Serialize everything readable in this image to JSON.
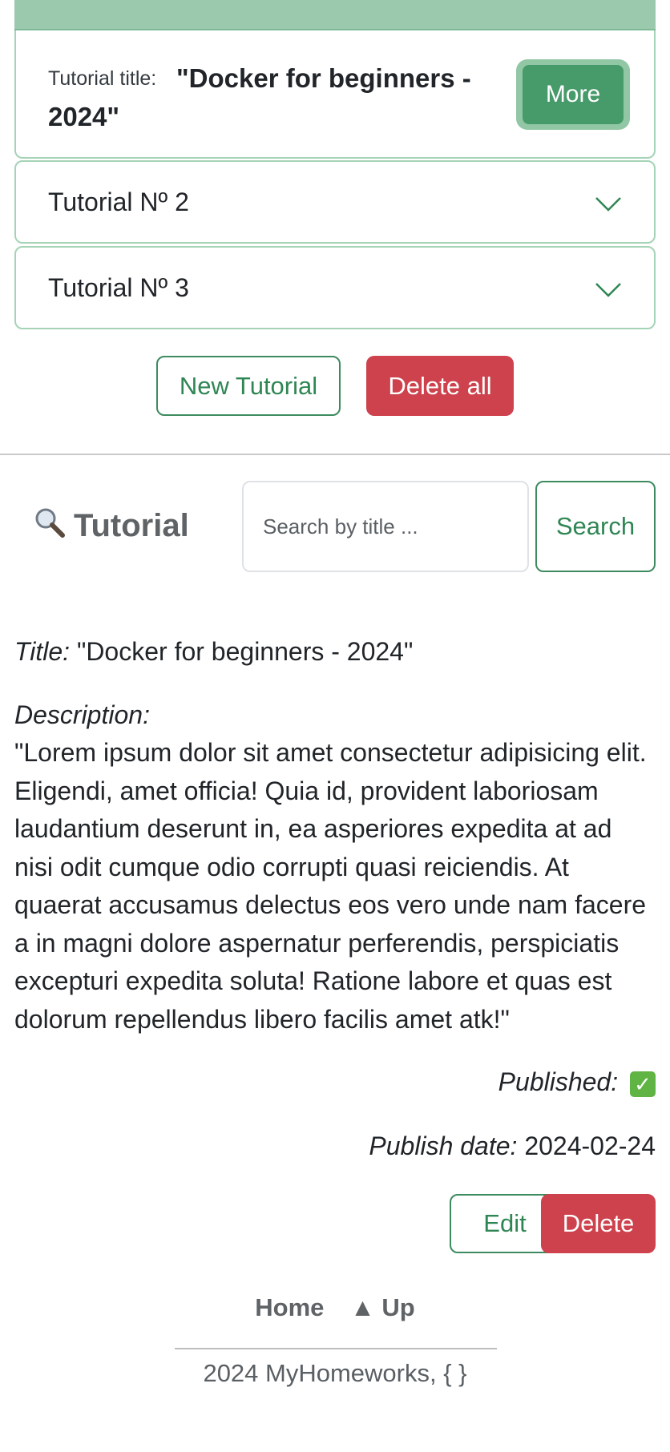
{
  "accordion": {
    "open_item": {
      "title_label": "Tutorial title:",
      "title_value": "\"Docker for beginners - 2024\"",
      "more_button": "More"
    },
    "items": [
      {
        "label": "Tutorial Nº 2"
      },
      {
        "label": "Tutorial Nº 3"
      }
    ]
  },
  "actions": {
    "new_tutorial": "New Tutorial",
    "delete_all": "Delete all"
  },
  "search": {
    "brand": "Tutorial",
    "brand_icon": "magnifier-icon",
    "placeholder": "Search by title ...",
    "button": "Search"
  },
  "tutorial": {
    "title_label": "Title:",
    "title_value": "\"Docker for beginners - 2024\"",
    "description_label": "Description:",
    "description_value": "\"Lorem ipsum dolor sit amet consectetur adipisicing elit. Eligendi, amet officia! Quia id, provident laboriosam laudantium deserunt in, ea asperiores expedita at ad nisi odit cumque odio corrupti quasi reiciendis. At quaerat accusamus delectus eos vero unde nam facere a in magni dolore aspernatur perferendis, perspiciatis excepturi expedita soluta! Ratione labore et quas est dolorum repellendus libero facilis amet atk!\"",
    "published_label": "Published:",
    "published_icon": "check-mark-icon",
    "publish_date_label": "Publish date:",
    "publish_date_value": "2024-02-24",
    "edit_button": "Edit",
    "delete_button": "Delete"
  },
  "footer": {
    "home_link": "Home",
    "up_link": "▲ Up",
    "copyright": "2024 MyHomeworks, { }"
  },
  "colors": {
    "accent_green": "#2f8654",
    "danger_red": "#cd424c",
    "accordion_header": "#9bc9ae"
  }
}
